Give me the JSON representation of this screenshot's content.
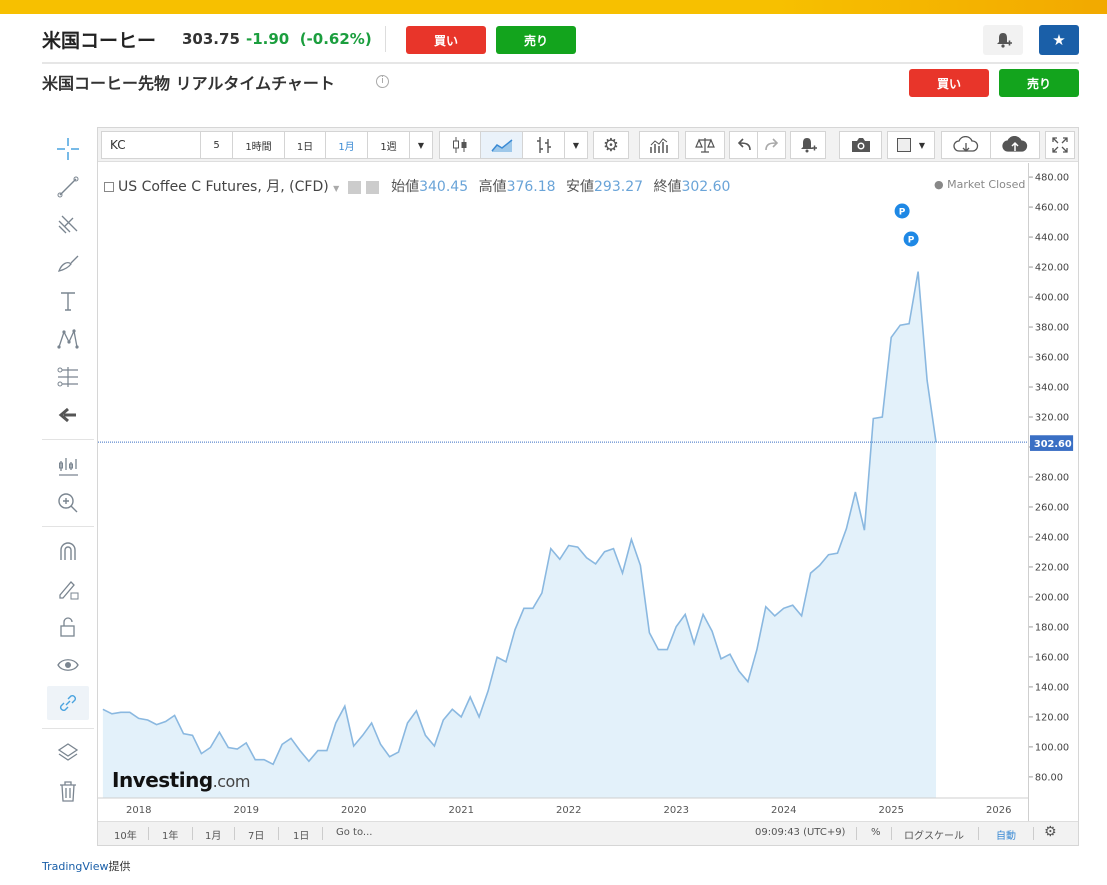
{
  "header": {
    "name": "米国コーヒー",
    "price": "303.75",
    "change": "-1.90",
    "change_pct": "(-0.62%)",
    "buy_label": "買い",
    "sell_label": "売り"
  },
  "title": {
    "text": "米国コーヒー先物 リアルタイムチャート",
    "info": "i",
    "buy_label": "買い",
    "sell_label": "売り"
  },
  "toolbar": {
    "symbol": "KC",
    "interval_5": "5",
    "interval_1h": "1時間",
    "interval_1d": "1日",
    "interval_1m": "1月",
    "interval_1w": "1週"
  },
  "legend": {
    "series": "US Coffee C Futures, 月, (CFD)",
    "open_label": "始値",
    "open": "340.45",
    "high_label": "高値",
    "high": "376.18",
    "low_label": "安値",
    "low": "293.27",
    "close_label": "終値",
    "close": "302.60",
    "status": "● Market Closed"
  },
  "watermark": {
    "brand": "Investing",
    "suffix": ".com"
  },
  "bottom": {
    "range_10y": "10年",
    "range_1y": "1年",
    "range_1m": "1月",
    "range_7d": "7日",
    "range_1d": "1日",
    "goto": "Go to...",
    "time": "09:09:43 (UTC+9)",
    "pct": "%",
    "log": "ログスケール",
    "auto": "自動"
  },
  "footer": {
    "provider_link": "TradingView",
    "provider_suffix": "提供"
  },
  "colors": {
    "line": "#8ab8e0",
    "fill": "#e3f1fa",
    "accent": "#3a6fc4",
    "buy": "#e8352a",
    "sell": "#13a41d"
  },
  "chart_data": {
    "type": "area",
    "ylim": [
      70,
      485
    ],
    "y_ticks": [
      "480.00",
      "460.00",
      "440.00",
      "420.00",
      "400.00",
      "380.00",
      "360.00",
      "340.00",
      "320.00",
      "300.00",
      "280.00",
      "260.00",
      "240.00",
      "220.00",
      "200.00",
      "180.00",
      "160.00",
      "140.00",
      "120.00",
      "100.00",
      "80.00"
    ],
    "x_ticks": [
      "2018",
      "2019",
      "2020",
      "2021",
      "2022",
      "2023",
      "2024",
      "2025",
      "2026"
    ],
    "last_value_label": "302.60",
    "last_value": 302.6,
    "markers": [
      "P",
      "P"
    ],
    "x": [
      "2017-09",
      "2017-10",
      "2017-11",
      "2017-12",
      "2018-01",
      "2018-02",
      "2018-03",
      "2018-04",
      "2018-05",
      "2018-06",
      "2018-07",
      "2018-08",
      "2018-09",
      "2018-10",
      "2018-11",
      "2018-12",
      "2019-01",
      "2019-02",
      "2019-03",
      "2019-04",
      "2019-05",
      "2019-06",
      "2019-07",
      "2019-08",
      "2019-09",
      "2019-10",
      "2019-11",
      "2019-12",
      "2020-01",
      "2020-02",
      "2020-03",
      "2020-04",
      "2020-05",
      "2020-06",
      "2020-07",
      "2020-08",
      "2020-09",
      "2020-10",
      "2020-11",
      "2020-12",
      "2021-01",
      "2021-02",
      "2021-03",
      "2021-04",
      "2021-05",
      "2021-06",
      "2021-07",
      "2021-08",
      "2021-09",
      "2021-10",
      "2021-11",
      "2021-12",
      "2022-01",
      "2022-02",
      "2022-03",
      "2022-04",
      "2022-05",
      "2022-06",
      "2022-07",
      "2022-08",
      "2022-09",
      "2022-10",
      "2022-11",
      "2022-12",
      "2023-01",
      "2023-02",
      "2023-03",
      "2023-04",
      "2023-05",
      "2023-06",
      "2023-07",
      "2023-08",
      "2023-09",
      "2023-10",
      "2023-11",
      "2023-12",
      "2024-01",
      "2024-02",
      "2024-03",
      "2024-04",
      "2024-05",
      "2024-06",
      "2024-07",
      "2024-08",
      "2024-09",
      "2024-10",
      "2024-11",
      "2024-12",
      "2025-01",
      "2025-02",
      "2025-03",
      "2025-04",
      "2025-05",
      "2025-06"
    ],
    "values": [
      128,
      125,
      126,
      126,
      122,
      121,
      118,
      120,
      124,
      112,
      111,
      99,
      103,
      113,
      103,
      102,
      106,
      95,
      95,
      92,
      105,
      109,
      101,
      94,
      101,
      101,
      119,
      130,
      104,
      111,
      119,
      105,
      97,
      100,
      119,
      127,
      111,
      104,
      121,
      128,
      123,
      136,
      123,
      140,
      162,
      159,
      180,
      194,
      194,
      204,
      233,
      226,
      235,
      234,
      227,
      223,
      231,
      233,
      217,
      239,
      222,
      178,
      167,
      167,
      182,
      190,
      171,
      190,
      179,
      161,
      164,
      153,
      146,
      167,
      195,
      189,
      194,
      196,
      189,
      217,
      222,
      229,
      230,
      246,
      270,
      245,
      318,
      319,
      371,
      379,
      380,
      414,
      343,
      302.6
    ]
  }
}
